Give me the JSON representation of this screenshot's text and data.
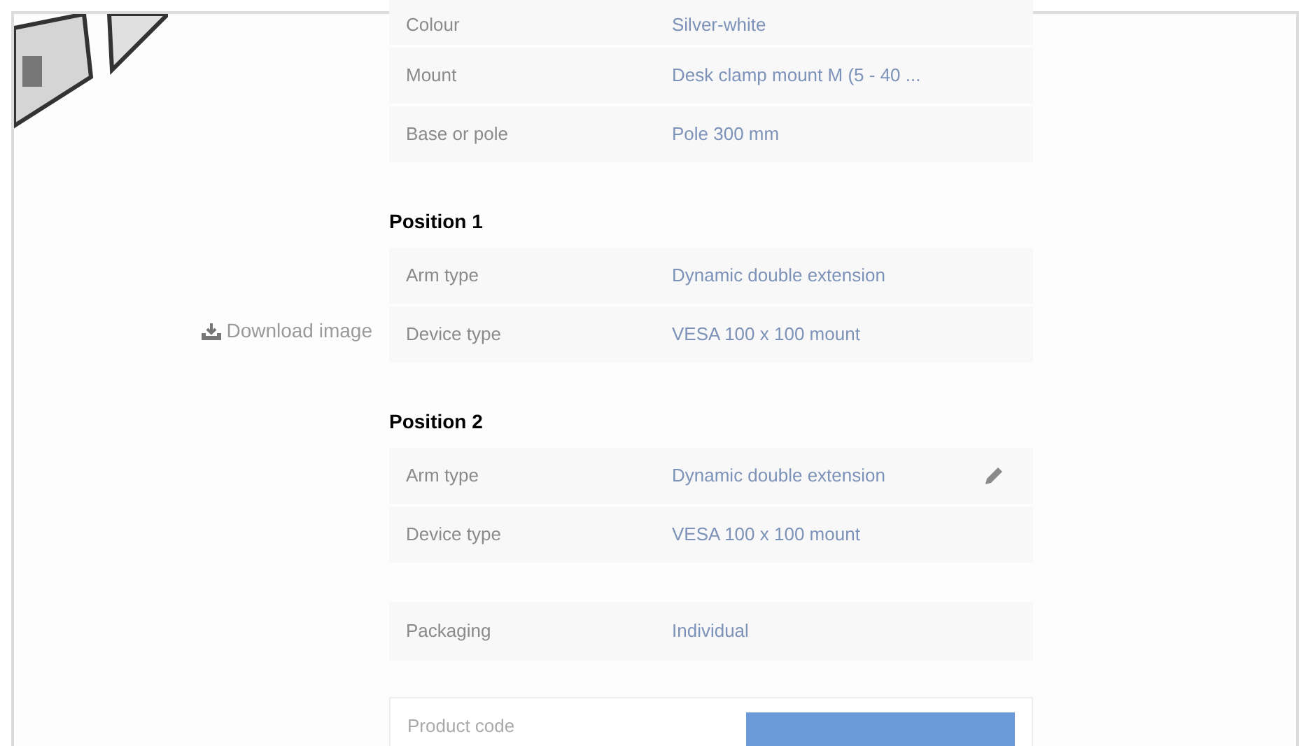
{
  "download_link": {
    "label": "Download image"
  },
  "general": [
    {
      "label": "Colour",
      "value": "Silver-white",
      "editable": false
    },
    {
      "label": "Mount",
      "value": "Desk clamp mount M (5 - 40 ...",
      "editable": false
    },
    {
      "label": "Base or pole",
      "value": "Pole 300 mm",
      "editable": false
    }
  ],
  "positions": [
    {
      "title": "Position 1",
      "rows": [
        {
          "label": "Arm type",
          "value": "Dynamic double extension",
          "editable": false
        },
        {
          "label": "Device type",
          "value": "VESA 100 x 100 mount",
          "editable": false
        }
      ]
    },
    {
      "title": "Position 2",
      "rows": [
        {
          "label": "Arm type",
          "value": "Dynamic double extension",
          "editable": true
        },
        {
          "label": "Device type",
          "value": "VESA 100 x 100 mount",
          "editable": false
        }
      ]
    }
  ],
  "packaging": {
    "label": "Packaging",
    "value": "Individual",
    "editable": false
  },
  "product_code": {
    "placeholder": "Product code"
  }
}
